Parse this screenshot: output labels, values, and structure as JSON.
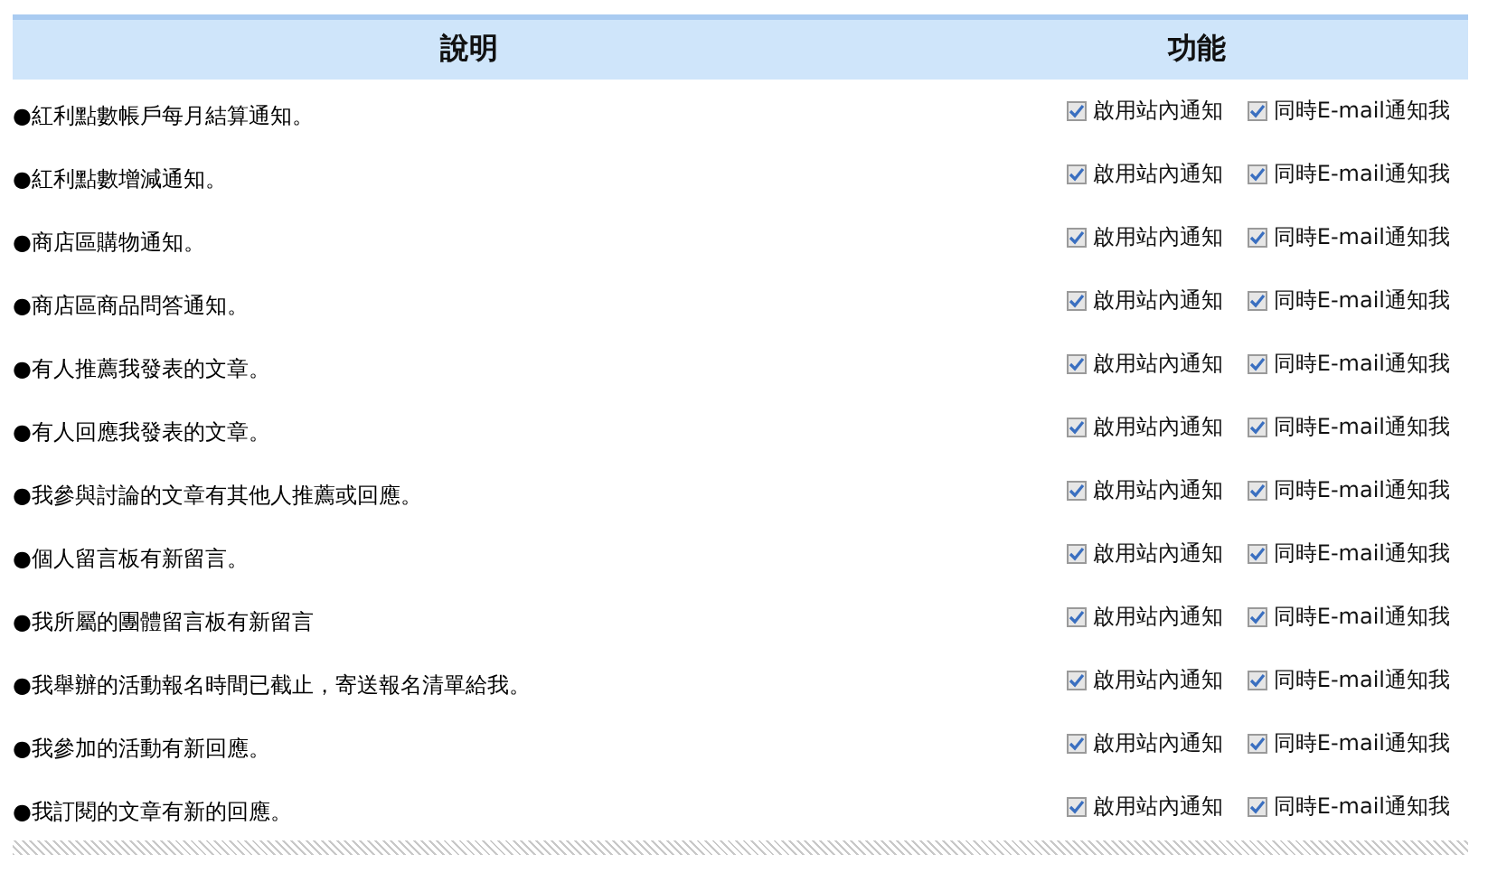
{
  "table": {
    "columns": [
      "說明",
      "功能"
    ],
    "rows": [
      {
        "description": "●紅利點數帳戶每月結算通知。",
        "options": [
          {
            "label": "啟用站內通知",
            "checked": true
          },
          {
            "label": "同時E-mail通知我",
            "checked": true
          }
        ]
      },
      {
        "description": "●紅利點數增減通知。",
        "options": [
          {
            "label": "啟用站內通知",
            "checked": true
          },
          {
            "label": "同時E-mail通知我",
            "checked": true
          }
        ]
      },
      {
        "description": "●商店區購物通知。",
        "options": [
          {
            "label": "啟用站內通知",
            "checked": true
          },
          {
            "label": "同時E-mail通知我",
            "checked": true
          }
        ]
      },
      {
        "description": "●商店區商品問答通知。",
        "options": [
          {
            "label": "啟用站內通知",
            "checked": true
          },
          {
            "label": "同時E-mail通知我",
            "checked": true
          }
        ]
      },
      {
        "description": "●有人推薦我發表的文章。",
        "options": [
          {
            "label": "啟用站內通知",
            "checked": true
          },
          {
            "label": "同時E-mail通知我",
            "checked": true
          }
        ]
      },
      {
        "description": "●有人回應我發表的文章。",
        "options": [
          {
            "label": "啟用站內通知",
            "checked": true
          },
          {
            "label": "同時E-mail通知我",
            "checked": true
          }
        ]
      },
      {
        "description": "●我參與討論的文章有其他人推薦或回應。",
        "options": [
          {
            "label": "啟用站內通知",
            "checked": true
          },
          {
            "label": "同時E-mail通知我",
            "checked": true
          }
        ]
      },
      {
        "description": "●個人留言板有新留言。",
        "options": [
          {
            "label": "啟用站內通知",
            "checked": true
          },
          {
            "label": "同時E-mail通知我",
            "checked": true
          }
        ]
      },
      {
        "description": "●我所屬的團體留言板有新留言",
        "options": [
          {
            "label": "啟用站內通知",
            "checked": true
          },
          {
            "label": "同時E-mail通知我",
            "checked": true
          }
        ]
      },
      {
        "description": "●我舉辦的活動報名時間已截止，寄送報名清單給我。",
        "options": [
          {
            "label": "啟用站內通知",
            "checked": true
          },
          {
            "label": "同時E-mail通知我",
            "checked": true
          }
        ]
      },
      {
        "description": "●我參加的活動有新回應。",
        "options": [
          {
            "label": "啟用站內通知",
            "checked": true
          },
          {
            "label": "同時E-mail通知我",
            "checked": true
          }
        ]
      },
      {
        "description": "●我訂閱的文章有新的回應。",
        "options": [
          {
            "label": "啟用站內通知",
            "checked": true
          },
          {
            "label": "同時E-mail通知我",
            "checked": true
          }
        ]
      }
    ]
  }
}
